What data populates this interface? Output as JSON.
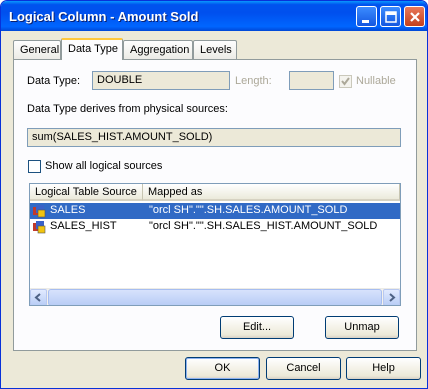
{
  "window": {
    "title": "Logical Column - Amount Sold"
  },
  "tabs": [
    {
      "label": "General"
    },
    {
      "label": "Data Type"
    },
    {
      "label": "Aggregation"
    },
    {
      "label": "Levels"
    }
  ],
  "data_type": {
    "label": "Data Type:",
    "value": "DOUBLE",
    "length_label": "Length:",
    "length_value": "",
    "nullable_label": "Nullable",
    "nullable_checked": true
  },
  "derives": {
    "label": "Data Type derives from physical sources:",
    "expression": "sum(SALES_HIST.AMOUNT_SOLD)"
  },
  "show_all": {
    "label": "Show all logical sources",
    "checked": false
  },
  "sources": {
    "columns": [
      "Logical Table Source",
      "Mapped as"
    ],
    "rows": [
      {
        "source": "SALES",
        "mapped": "\"orcl SH\".\"\".SH.SALES.AMOUNT_SOLD",
        "selected": true
      },
      {
        "source": "SALES_HIST",
        "mapped": "\"orcl SH\".\"\".SH.SALES_HIST.AMOUNT_SOLD",
        "selected": false
      }
    ]
  },
  "buttons": {
    "edit": "Edit...",
    "unmap": "Unmap",
    "ok": "OK",
    "cancel": "Cancel",
    "help": "Help"
  },
  "colors": {
    "titlebar": "#0054e3",
    "selection": "#316ac5",
    "tab_highlight": "#ffc83c"
  }
}
